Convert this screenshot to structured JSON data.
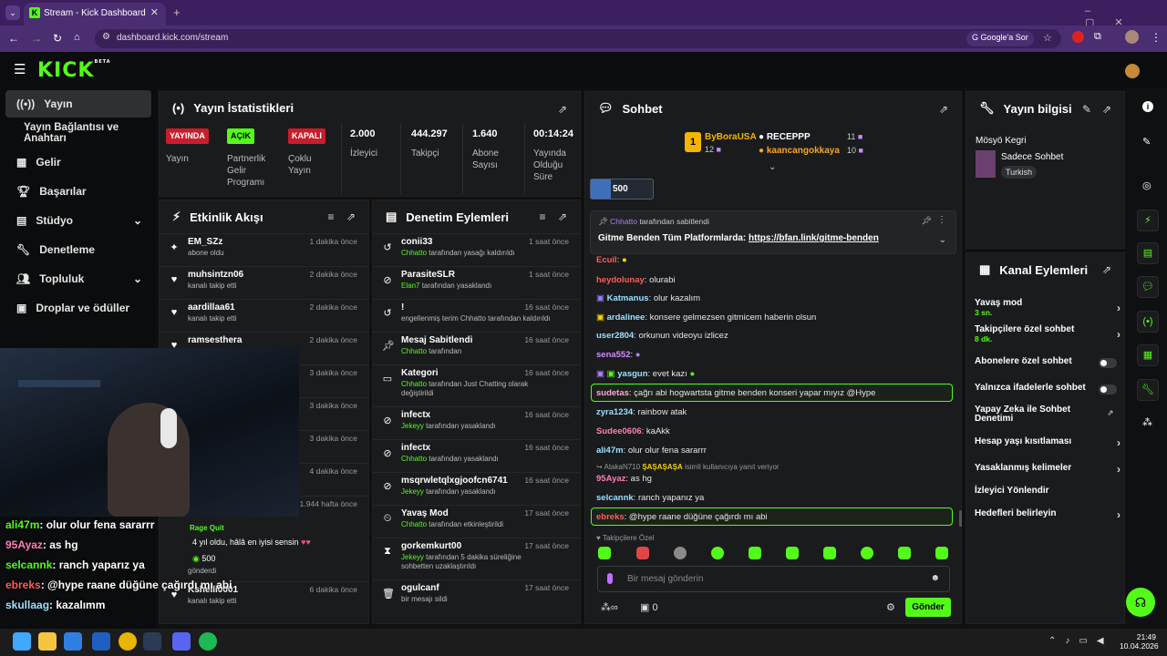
{
  "browser": {
    "tab_title": "Stream - Kick Dashboard",
    "url": "dashboard.kick.com/stream",
    "google_btn": "Google'a Sor"
  },
  "app": {
    "logo": "KICK",
    "logo_sup": "BETA"
  },
  "sidebar": {
    "items": [
      {
        "label": "Yayın"
      },
      {
        "label": "Yayın Bağlantısı ve Anahtarı"
      },
      {
        "label": "Gelir"
      },
      {
        "label": "Başarılar"
      },
      {
        "label": "Stüdyo"
      },
      {
        "label": "Denetleme"
      },
      {
        "label": "Topluluk"
      },
      {
        "label": "Droplar ve ödüller"
      }
    ]
  },
  "stats": {
    "title": "Yayın İstatistikleri",
    "badges": [
      {
        "badge": "YAYINDA",
        "label": "Yayın"
      },
      {
        "badge": "AÇIK",
        "label": "Partnerlik Gelir Programı"
      },
      {
        "badge": "KAPALI",
        "label": "Çoklu Yayın"
      }
    ],
    "values": [
      {
        "value": "2.000",
        "label": "İzleyici"
      },
      {
        "value": "444.297",
        "label": "Takipçi"
      },
      {
        "value": "1.640",
        "label": "Abone Sayısı"
      },
      {
        "value": "00:14:24",
        "label": "Yayında Olduğu Süre"
      }
    ]
  },
  "activity": {
    "title": "Etkinlik Akışı",
    "items": [
      {
        "name": "EM_SZz",
        "sub": "abone oldu",
        "time": "1 dakika önce"
      },
      {
        "name": "muhsintzn06",
        "sub": "kanalı takip etti",
        "time": "2 dakika önce"
      },
      {
        "name": "aardillaa61",
        "sub": "kanalı takip etti",
        "time": "2 dakika önce"
      },
      {
        "name": "ramsesthera",
        "sub": "",
        "time": "2 dakika önce"
      },
      {
        "name": "",
        "sub": "",
        "time": "3 dakika önce"
      },
      {
        "name": "",
        "sub": "",
        "time": "3 dakika önce"
      },
      {
        "name": "",
        "sub": "",
        "time": "3 dakika önce"
      },
      {
        "name": "",
        "sub": "",
        "time": "4 dakika önce"
      },
      {
        "name": "",
        "sub": "",
        "time": "1.944 hafta önce"
      }
    ],
    "gift_tag": "Rage Quit",
    "gift_msg": "4 yıl oldu, hâlâ en iyisi sensin",
    "gift_amount": "500",
    "gift_sub": "gönderdi",
    "last": {
      "name": "Kshelli0001",
      "sub": "kanalı takip etti",
      "time": "6 dakika önce"
    }
  },
  "moderation": {
    "title": "Denetim Eylemleri",
    "items": [
      {
        "name": "conii33",
        "sub_user": "Chhatto",
        "sub": "tarafından yasağı kaldırıldı",
        "time": "1 saat önce"
      },
      {
        "name": "ParasiteSLR",
        "sub_user": "Elan7",
        "sub": "tarafından yasaklandı",
        "time": "1 saat önce"
      },
      {
        "name": "!",
        "sub_user": "",
        "sub": "engellenmiş terim Chhatto tarafından kaldırıldı",
        "time": "16 saat önce"
      },
      {
        "name": "Mesaj Sabitlendi",
        "sub_user": "Chhatto",
        "sub": "tarafından",
        "time": "16 saat önce"
      },
      {
        "name": "Kategori",
        "sub_user": "Chhatto",
        "sub": "tarafından Just Chatting olarak değiştirildi",
        "time": "16 saat önce"
      },
      {
        "name": "infectx",
        "sub_user": "Jekeyy",
        "sub": "tarafından yasaklandı",
        "time": "16 saat önce"
      },
      {
        "name": "infectx",
        "sub_user": "Chhatto",
        "sub": "tarafından yasaklandı",
        "time": "16 saat önce"
      },
      {
        "name": "msqrwletqlxgjoofcn6741",
        "sub_user": "Jekeyy",
        "sub": "tarafından yasaklandı",
        "time": "16 saat önce"
      },
      {
        "name": "Yavaş Mod",
        "sub_user": "Chhatto",
        "sub": "tarafından etkinleştirildi",
        "time": "17 saat önce"
      },
      {
        "name": "gorkemkurt00",
        "sub_user": "Jekeyy",
        "sub": "tarafından 5 dakika süreliğine sohbetten uzaklaştırıldı",
        "time": "17 saat önce"
      },
      {
        "name": "ogulcanf",
        "sub_user": "",
        "sub": "bir mesajı sildi",
        "time": "17 saat önce"
      }
    ]
  },
  "chat": {
    "title": "Sohbet",
    "leaders": [
      {
        "name": "ByBoraUSA",
        "count": "12"
      },
      {
        "name": "RECEPPP",
        "count": "11"
      },
      {
        "name": "kaancangokkaya",
        "count": "10"
      }
    ],
    "goal": "500",
    "pinned_by": "Chhatto",
    "pinned_suffix": "tarafından sabitlendi",
    "pinned_text": "Gitme Benden Tüm Platformlarda:",
    "pinned_link": "https://bfan.link/gitme-benden",
    "messages": [
      {
        "user": "Ecuil",
        "text": ":",
        "color": "#ff5b5b"
      },
      {
        "user": "heydolunay",
        "text": ": olurabi",
        "color": "#ff5b5b"
      },
      {
        "user": "Katmanus",
        "text": ": olur kazalım",
        "color": "#9be0ff"
      },
      {
        "user": "ardalinee",
        "text": ": konsere gelmezsen gitmicem haberin olsun",
        "color": "#9be0ff"
      },
      {
        "user": "user2804",
        "text": ": orkunun videoyu izlicez",
        "color": "#9be0ff"
      },
      {
        "user": "sena552",
        "text": ":",
        "color": "#d08bff"
      },
      {
        "user": "yasgun",
        "text": ": evet kazı",
        "color": "#9be0ff"
      },
      {
        "user": "sudetas",
        "text": ": çağrı abi hogwartsta gitme benden konseri yapar mıyız @Hype",
        "color": "#ffa6d9"
      },
      {
        "user": "zyra1234",
        "text": ": rainbow atak",
        "color": "#9be0ff"
      },
      {
        "user": "Sudee0606",
        "text": ": kaAkk",
        "color": "#ff7eb9"
      },
      {
        "user": "ali47m",
        "text": ": olur olur fena sararrr",
        "color": "#9be0ff"
      },
      {
        "user": "95Ayaz",
        "text": ": as hg",
        "color": "#ff7eb9"
      },
      {
        "user": "selcannk",
        "text": ": ranch yapanız ya",
        "color": "#9be0ff"
      },
      {
        "user": "ebreks",
        "text": ": @hype raane düğüne çağırdı mı abi",
        "color": "#ff5b5b"
      }
    ],
    "reply_to": "AtakaN710",
    "reply_suffix": "isimli kullanıcıya yanıt veriyor",
    "followers_only": "Takipçilere Özel",
    "input_placeholder": "Bir mesaj gönderin",
    "send": "Gönder",
    "points": "0"
  },
  "info": {
    "title": "Yayın bilgisi",
    "channel": "Mösyö Kegri",
    "category": "Sadece Sohbet",
    "language": "Turkish"
  },
  "actions": {
    "title": "Kanal Eylemleri",
    "items": [
      {
        "label": "Yavaş mod",
        "sub": "3 sn."
      },
      {
        "label": "Takipçilere özel sohbet",
        "sub": "8 dk."
      },
      {
        "label": "Abonelere özel sohbet",
        "sub": ""
      },
      {
        "label": "Yalnızca ifadelerle sohbet",
        "sub": ""
      },
      {
        "label": "Yapay Zeka ile Sohbet Denetimi",
        "sub": ""
      },
      {
        "label": "Hesap yaşı kısıtlaması",
        "sub": ""
      },
      {
        "label": "Yasaklanmış kelimeler",
        "sub": ""
      },
      {
        "label": "İzleyici Yönlendir",
        "sub": ""
      },
      {
        "label": "Hedefleri belirleyin",
        "sub": ""
      }
    ]
  },
  "overlay": [
    {
      "user": "ali47m",
      "text": ": olur olur fena sararrr",
      "color": "#53fc18"
    },
    {
      "user": "95Ayaz",
      "text": ": as hg",
      "color": "#ff7eb9"
    },
    {
      "user": "selcannk",
      "text": ": ranch yaparız ya",
      "color": "#53fc18"
    },
    {
      "user": "ebreks",
      "text": ": @hype raane düğüne çağırdı mı abi",
      "color": "#ff5b5b"
    },
    {
      "user": "skullaag",
      "text": ": kazalımm",
      "color": "#9be0ff"
    }
  ],
  "taskbar": {
    "time": "21:49",
    "date": "10.04.2026"
  }
}
